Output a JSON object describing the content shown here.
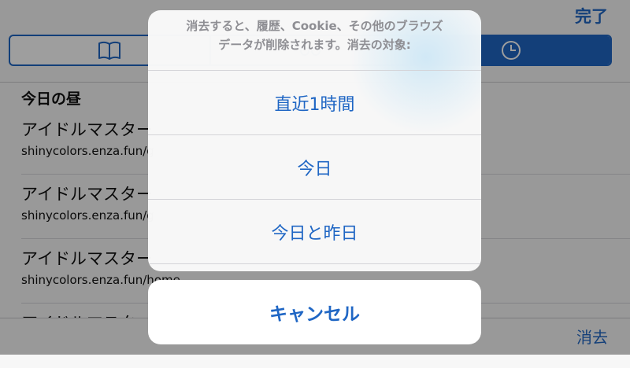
{
  "header": {
    "done_label": "完了"
  },
  "segments": [
    {
      "icon": "book-icon",
      "active": false
    },
    {
      "icon": "clock-icon",
      "active": true
    }
  ],
  "history": {
    "section_title": "今日の昼",
    "items": [
      {
        "title": "アイドルマスター",
        "url": "shinycolors.enza.fun/g"
      },
      {
        "title": "アイドルマスター",
        "url": "shinycolors.enza.fun/g"
      },
      {
        "title": "アイドルマスター",
        "url": "shinycolors.enza.fun/home"
      },
      {
        "title": "アイドルマスター",
        "url": ""
      }
    ]
  },
  "toolbar": {
    "clear_label": "消去"
  },
  "action_sheet": {
    "message_line1": "消去すると、履歴、Cookie、その他のブラウズ",
    "message_line2": "データが削除されます。消去の対象:",
    "options": [
      "直近1時間",
      "今日",
      "今日と昨日"
    ],
    "cancel_label": "キャンセル"
  },
  "colors": {
    "accent": "#1f66c4",
    "message_text": "#8e8e93"
  }
}
